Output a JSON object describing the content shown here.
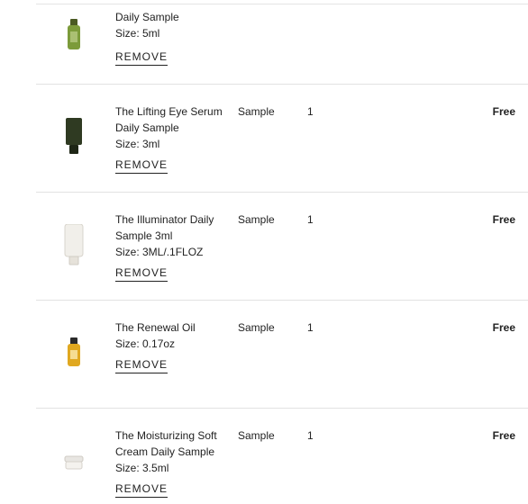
{
  "cart": {
    "remove_label": "REMOVE",
    "items": [
      {
        "name_line1": "Daily Sample",
        "size": "Size: 5ml",
        "type": "",
        "qty": "",
        "price": "",
        "product_icon": "green-oil-bottle-icon"
      },
      {
        "name_line1": "The Lifting Eye Serum",
        "name_line2": "Daily Sample",
        "size": "Size: 3ml",
        "type": "Sample",
        "qty": "1",
        "price": "Free",
        "product_icon": "dark-green-tube-icon"
      },
      {
        "name_line1": "The Illuminator Daily",
        "name_line2": "Sample 3ml",
        "size": "Size: 3ML/.1FLOZ",
        "type": "Sample",
        "qty": "1",
        "price": "Free",
        "product_icon": "white-tube-icon"
      },
      {
        "name_line1": "The Renewal Oil",
        "size": "Size: 0.17oz",
        "type": "Sample",
        "qty": "1",
        "price": "Free",
        "product_icon": "amber-oil-bottle-icon"
      },
      {
        "name_line1": "The Moisturizing Soft",
        "name_line2": "Cream Daily Sample",
        "size": "Size: 3.5ml",
        "type": "Sample",
        "qty": "1",
        "price": "Free",
        "product_icon": "cream-jar-icon"
      }
    ]
  }
}
